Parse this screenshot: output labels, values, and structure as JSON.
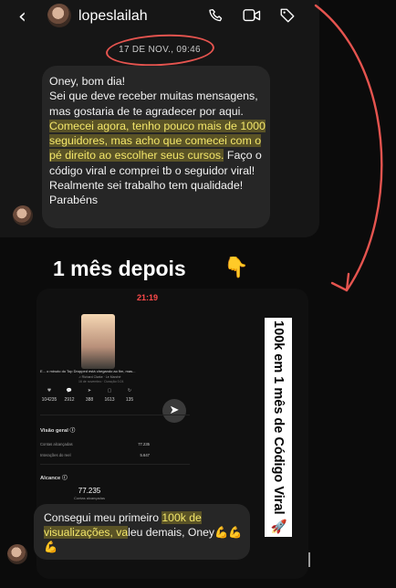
{
  "header": {
    "username": "lopeslailah",
    "back_icon": "chevron-left-icon",
    "actions": [
      "phone-icon",
      "video-icon",
      "tag-icon"
    ]
  },
  "conversation": {
    "date_label": "17 DE NOV., 09:46",
    "message1_parts": [
      {
        "text": "Oney, bom dia!\nSei que deve receber muitas mensagens, mas gostaria de te agradecer por aqui. ",
        "highlight": false
      },
      {
        "text": "Comecei agora, tenho pouco mais de 1000 seguidores, mas acho que comecei com o pé direito ao escolher seus cursos.",
        "highlight": true
      },
      {
        "text": " Faço o código viral e comprei tb o seguidor viral!\nRealmente sei trabalho tem qualidade!\nParabéns",
        "highlight": false
      }
    ]
  },
  "headline": {
    "text": "1 mês depois",
    "emoji": "👇"
  },
  "insights": {
    "time": "21:19",
    "reel_title": "E... o minuto do Top Dropped está chegando ao fim, mas...",
    "reel_sub": "♫ Richard Clarke · Le Marché",
    "reel_date": "16 de novembro · Duração 0:24",
    "stats": [
      {
        "icon": "♥",
        "value": "104235"
      },
      {
        "icon": "💬",
        "value": "2912"
      },
      {
        "icon": "➤",
        "value": "388"
      },
      {
        "icon": "▢",
        "value": "1613"
      },
      {
        "icon": "↻",
        "value": "135"
      }
    ],
    "overview_title": "Visão geral ⓘ",
    "overview_rows": [
      {
        "label": "Contas alcançadas",
        "value": "77.235"
      },
      {
        "label": "Interações do reel",
        "value": "5.647"
      }
    ],
    "reach_title": "Alcance ⓘ",
    "reach_value": "77.235",
    "reach_label": "Contas alcançadas"
  },
  "reply": {
    "part1": "Consegui meu primeiro ",
    "highlight": "100k de visualizações, va",
    "part2": "leu demais, Oney",
    "emojis": "💪💪💪"
  },
  "vertical_label": "100k em 1 mês de Código Viral 🚀",
  "colors": {
    "accent_red": "#e5544f",
    "highlight_yellow": "#f3e66a",
    "bubble": "#262626"
  }
}
